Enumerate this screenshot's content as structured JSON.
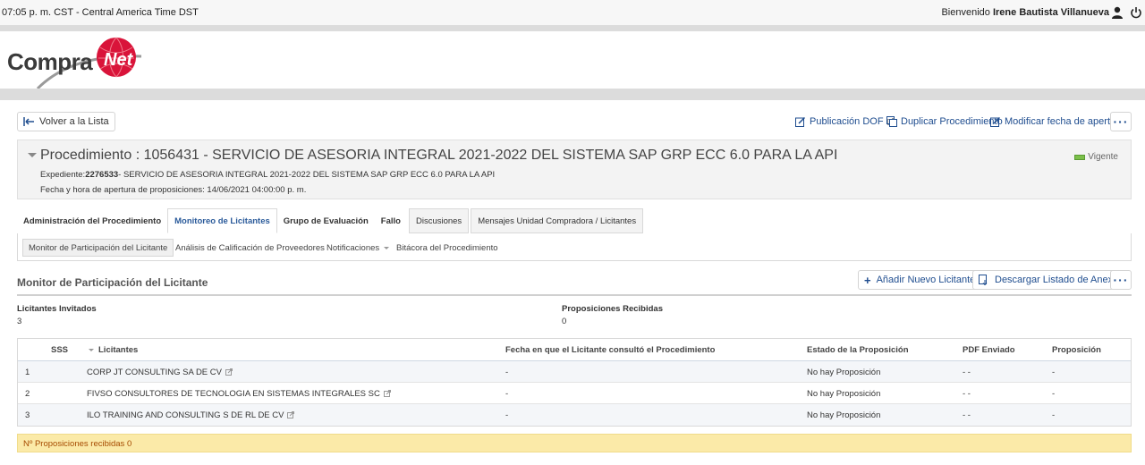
{
  "topbar": {
    "time": "07:05 p. m. CST - Central America Time DST",
    "welcome_prefix": "Bienvenido",
    "user_name": "Irene Bautista Villanueva"
  },
  "logo": {
    "text": "Compra",
    "ball_text": "Net"
  },
  "actions": {
    "back": "Volver a la Lista",
    "publicacion": "Publicación DOF",
    "duplicar": "Duplicar Procedimiento",
    "modificar": "Modificar fecha de apertura",
    "more": "···"
  },
  "procedure": {
    "title": "Procedimiento : 1056431 - SERVICIO DE ASESORIA INTEGRAL 2021-2022 DEL SISTEMA SAP GRP ECC 6.0 PARA LA API",
    "exp_label": "Expediente:",
    "exp_number": "2276533",
    "exp_desc": "- SERVICIO DE ASESORIA INTEGRAL 2021-2022 DEL SISTEMA SAP GRP ECC 6.0 PARA LA API",
    "fecha": "Fecha y hora de apertura de proposiciones: 14/06/2021 04:00:00 p. m.",
    "status": "Vigente"
  },
  "tabs": [
    "Administración del Procedimiento",
    "Monitoreo de Licitantes",
    "Grupo de Evaluación",
    "Fallo",
    "Discusiones",
    "Mensajes Unidad Compradora / Licitantes"
  ],
  "subtabs": [
    "Monitor de Participación del Licitante",
    "Análisis de Calificación de Proveedores",
    "Notificaciones",
    "Bitácora del Procedimiento"
  ],
  "section": {
    "title": "Monitor de Participación del Licitante",
    "add_button": "Añadir Nuevo Licitante",
    "download_button": "Descargar Listado de Anexos"
  },
  "stats": {
    "invitados_label": "Licitantes Invitados",
    "invitados_value": "3",
    "recibidas_label": "Proposiciones Recibidas",
    "recibidas_value": "0"
  },
  "table": {
    "headers": [
      "SSS",
      "Licitantes",
      "Fecha en que el Licitante consultó el Procedimiento",
      "Estado de la Proposición",
      "PDF Enviado",
      "Proposición"
    ],
    "rows": [
      [
        "1",
        "CORP JT CONSULTING SA DE CV",
        "-",
        "No hay Proposición",
        "- -",
        "-"
      ],
      [
        "2",
        "FIVSO CONSULTORES DE TECNOLOGIA EN SISTEMAS INTEGRALES SC",
        "-",
        "No hay Proposición",
        "- -",
        "-"
      ],
      [
        "3",
        "ILO TRAINING AND CONSULTING S DE RL DE CV",
        "-",
        "No hay Proposición",
        "- -",
        "-"
      ]
    ]
  },
  "notice": "Nº Proposiciones recibidas 0",
  "colors": {
    "link": "#1f4d8f",
    "notice_bg": "#fbeaa8",
    "notice_text": "#a64b00",
    "logo_red": "#d9143a"
  }
}
